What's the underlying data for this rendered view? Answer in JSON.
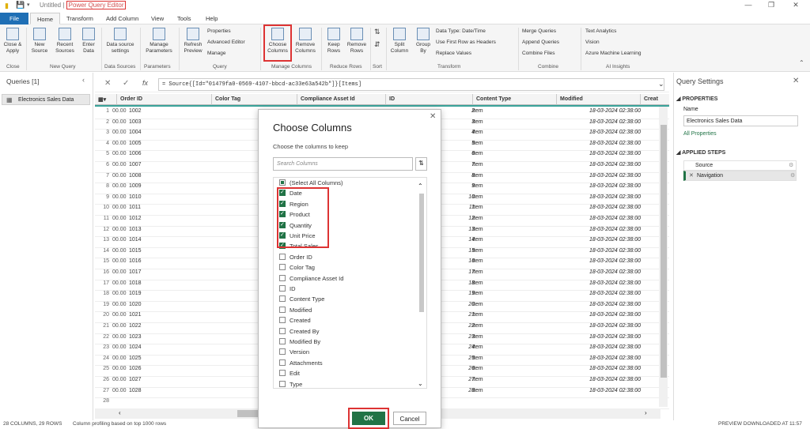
{
  "titlebar": {
    "doc": "Untitled",
    "app": "Power Query Editor",
    "sep": "|"
  },
  "tabs": [
    "File",
    "Home",
    "Transform",
    "Add Column",
    "View",
    "Tools",
    "Help"
  ],
  "ribbon": {
    "close_apply": "Close & Apply",
    "new_source": "New Source",
    "recent_sources": "Recent Sources",
    "enter_data": "Enter Data",
    "ds_settings": "Data source settings",
    "manage_params": "Manage Parameters",
    "refresh": "Refresh Preview",
    "properties": "Properties",
    "advanced_editor": "Advanced Editor",
    "manage": "Manage",
    "choose_columns": "Choose Columns",
    "remove_columns": "Remove Columns",
    "keep_rows": "Keep Rows",
    "remove_rows": "Remove Rows",
    "split_column": "Split Column",
    "group_by": "Group By",
    "data_type": "Data Type: Date/Time",
    "first_row": "Use First Row as Headers",
    "replace_values": "Replace Values",
    "merge_queries": "Merge Queries",
    "append_queries": "Append Queries",
    "combine_files": "Combine Files",
    "text_analytics": "Text Analytics",
    "vision": "Vision",
    "azure_ml": "Azure Machine Learning",
    "groups": [
      "Close",
      "New Query",
      "Data Sources",
      "Parameters",
      "Query",
      "Manage Columns",
      "Reduce Rows",
      "Sort",
      "Transform",
      "Combine",
      "AI Insights"
    ]
  },
  "queries": {
    "header": "Queries [1]",
    "item": "Electronics Sales Data"
  },
  "formula": "= Source{[Id=\"01479fa0-0569-4107-bbcd-ac33e63a542b\"]}[Items]",
  "columns": [
    "Order ID",
    "Color Tag",
    "Compliance Asset Id",
    "ID",
    "Content Type",
    "Modified",
    "Creat"
  ],
  "rows": [
    {
      "n": "1",
      "a": "00.00",
      "id": "1002",
      "num": "2"
    },
    {
      "n": "2",
      "a": "00.00",
      "id": "1003",
      "num": "3"
    },
    {
      "n": "3",
      "a": "00.00",
      "id": "1004",
      "num": "4"
    },
    {
      "n": "4",
      "a": "00.00",
      "id": "1005",
      "num": "5"
    },
    {
      "n": "5",
      "a": "00.00",
      "id": "1006",
      "num": "6"
    },
    {
      "n": "6",
      "a": "00.00",
      "id": "1007",
      "num": "7"
    },
    {
      "n": "7",
      "a": "00.00",
      "id": "1008",
      "num": "8"
    },
    {
      "n": "8",
      "a": "00.00",
      "id": "1009",
      "num": "9"
    },
    {
      "n": "9",
      "a": "00.00",
      "id": "1010",
      "num": "10"
    },
    {
      "n": "10",
      "a": "00.00",
      "id": "1011",
      "num": "11"
    },
    {
      "n": "11",
      "a": "00.00",
      "id": "1012",
      "num": "12"
    },
    {
      "n": "12",
      "a": "00.00",
      "id": "1013",
      "num": "13"
    },
    {
      "n": "13",
      "a": "00.00",
      "id": "1014",
      "num": "14"
    },
    {
      "n": "14",
      "a": "00.00",
      "id": "1015",
      "num": "15"
    },
    {
      "n": "15",
      "a": "00.00",
      "id": "1016",
      "num": "16"
    },
    {
      "n": "16",
      "a": "00.00",
      "id": "1017",
      "num": "17"
    },
    {
      "n": "17",
      "a": "00.00",
      "id": "1018",
      "num": "18"
    },
    {
      "n": "18",
      "a": "00.00",
      "id": "1019",
      "num": "19"
    },
    {
      "n": "19",
      "a": "00.00",
      "id": "1020",
      "num": "20"
    },
    {
      "n": "20",
      "a": "00.00",
      "id": "1021",
      "num": "21"
    },
    {
      "n": "21",
      "a": "00.00",
      "id": "1022",
      "num": "22"
    },
    {
      "n": "22",
      "a": "00.00",
      "id": "1023",
      "num": "23"
    },
    {
      "n": "23",
      "a": "00.00",
      "id": "1024",
      "num": "24"
    },
    {
      "n": "24",
      "a": "00.00",
      "id": "1025",
      "num": "25"
    },
    {
      "n": "25",
      "a": "00.00",
      "id": "1026",
      "num": "26"
    },
    {
      "n": "26",
      "a": "00.00",
      "id": "1027",
      "num": "27"
    },
    {
      "n": "27",
      "a": "00.00",
      "id": "1028",
      "num": "28"
    },
    {
      "n": "28",
      "a": "",
      "id": "",
      "num": ""
    }
  ],
  "cell_type": "Item",
  "cell_date": "18-03-2024 02:38:00",
  "right": {
    "title": "Query Settings",
    "properties": "PROPERTIES",
    "name_label": "Name",
    "name_value": "Electronics Sales Data",
    "all_props": "All Properties",
    "applied": "APPLIED STEPS",
    "steps": [
      "Source",
      "Navigation"
    ]
  },
  "status": {
    "left": "28 COLUMNS, 29 ROWS",
    "profiling": "Column profiling based on top 1000 rows",
    "right": "PREVIEW DOWNLOADED AT 11:57"
  },
  "dialog": {
    "title": "Choose Columns",
    "subtitle": "Choose the columns to keep",
    "search_placeholder": "Search Columns",
    "ok": "OK",
    "cancel": "Cancel",
    "items": [
      {
        "label": "(Select All Columns)",
        "state": "part"
      },
      {
        "label": "Date",
        "state": "on"
      },
      {
        "label": "Region",
        "state": "on"
      },
      {
        "label": "Product",
        "state": "on"
      },
      {
        "label": "Quantity",
        "state": "on"
      },
      {
        "label": "Unit Price",
        "state": "on"
      },
      {
        "label": "Total Sales",
        "state": "on"
      },
      {
        "label": "Order ID",
        "state": "off"
      },
      {
        "label": "Color Tag",
        "state": "off"
      },
      {
        "label": "Compliance Asset Id",
        "state": "off"
      },
      {
        "label": "ID",
        "state": "off"
      },
      {
        "label": "Content Type",
        "state": "off"
      },
      {
        "label": "Modified",
        "state": "off"
      },
      {
        "label": "Created",
        "state": "off"
      },
      {
        "label": "Created By",
        "state": "off"
      },
      {
        "label": "Modified By",
        "state": "off"
      },
      {
        "label": "Version",
        "state": "off"
      },
      {
        "label": "Attachments",
        "state": "off"
      },
      {
        "label": "Edit",
        "state": "off"
      },
      {
        "label": "Type",
        "state": "off"
      }
    ]
  }
}
